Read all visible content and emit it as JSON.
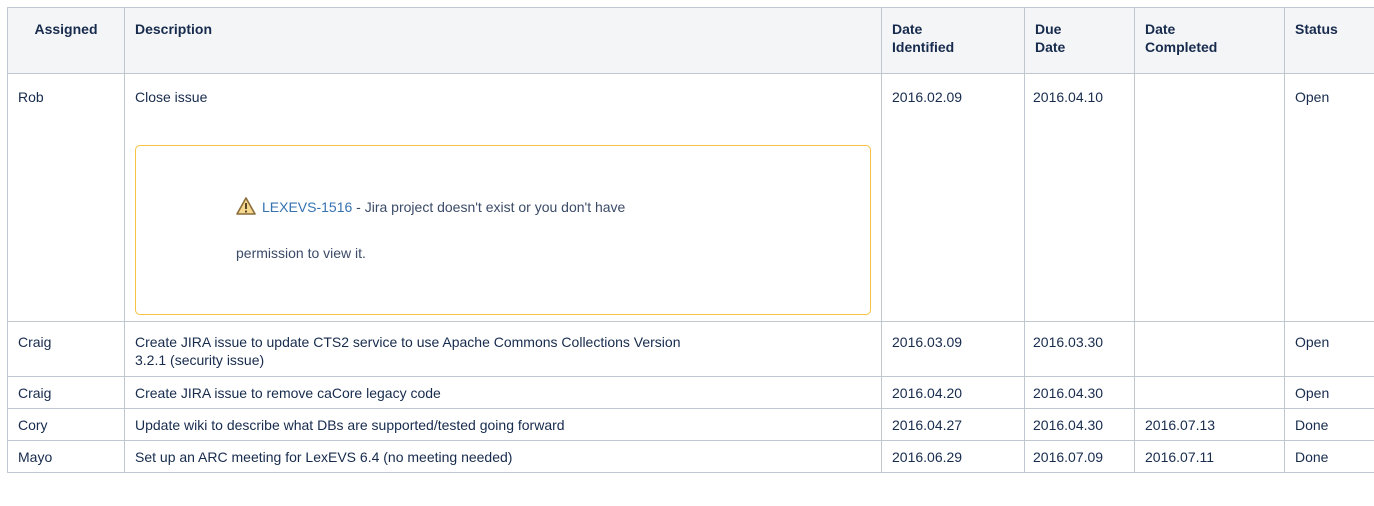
{
  "headers": {
    "assigned": "Assigned",
    "description": "Description",
    "date_identified_1": "Date",
    "date_identified_2": "Identified",
    "due_date_1": "Due",
    "due_date_2": "Date",
    "date_completed_1": "Date",
    "date_completed_2": "Completed",
    "status": "Status"
  },
  "rows": [
    {
      "assigned": "Rob",
      "description": "Close issue",
      "jira": {
        "key": "LEXEVS-1516",
        "message_line1": " - Jira project doesn't exist or you don't have",
        "message_line2": "permission to view it."
      },
      "date_identified": "2016.02.09",
      "due_date": "2016.04.10",
      "date_completed": "",
      "status": "Open"
    },
    {
      "assigned": "Craig",
      "description_line1": "Create JIRA issue to update CTS2 service to use Apache Commons Collections Version",
      "description_line2": "3.2.1 (security issue)",
      "date_identified": "2016.03.09",
      "due_date": "2016.03.30",
      "date_completed": "",
      "status": "Open"
    },
    {
      "assigned": "Craig",
      "description": "Create JIRA issue to remove caCore legacy code",
      "date_identified": "2016.04.20",
      "due_date": "2016.04.30",
      "date_completed": "",
      "status": "Open"
    },
    {
      "assigned": "Cory",
      "description": "Update wiki to describe what DBs are supported/tested going forward",
      "date_identified": "2016.04.27",
      "due_date": "2016.04.30",
      "date_completed": "2016.07.13",
      "status": "Done"
    },
    {
      "assigned": "Mayo",
      "description": "Set up an ARC meeting for LexEVS 6.4 (no meeting needed)",
      "date_identified": "2016.06.29",
      "due_date": "2016.07.09",
      "date_completed": "2016.07.11",
      "status": "Done"
    }
  ],
  "icons": {
    "warning": "warning-triangle-icon"
  },
  "colors": {
    "link": "#3572b0",
    "warning_border": "#f6c342",
    "header_bg": "#f4f5f7",
    "grid": "#c1c7d0"
  }
}
